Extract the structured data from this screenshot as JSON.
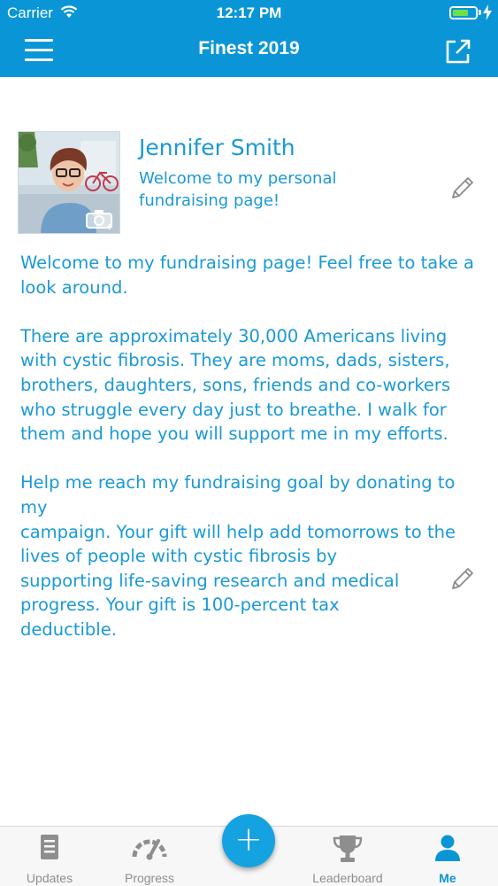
{
  "status_bar": {
    "carrier": "Carrier",
    "time": "12:17 PM",
    "battery_level": 0.7
  },
  "nav": {
    "title": "Finest 2019",
    "menu_icon": "hamburger-menu-icon",
    "share_icon": "external-share-icon"
  },
  "profile": {
    "name": "Jennifer Smith",
    "tagline": "Welcome to my personal fundraising page!",
    "photo_badge_icon": "camera-icon"
  },
  "story": {
    "paragraphs": [
      "Welcome to my fundraising page! Feel free to take a\nlook around.",
      "There are approximately 30,000 Americans living\nwith cystic fibrosis. They are moms, dads, sisters,\nbrothers, daughters, sons, friends and co-workers\nwho struggle every day just to breathe. I walk for\nthem and hope you will support me in my efforts.",
      "Help me reach my fundraising goal by donating to my\ncampaign. Your gift will help add tomorrows to the\nlives of people with cystic fibrosis by\nsupporting life-saving research and medical\nprogress. Your gift is 100-percent tax\ndeductible."
    ]
  },
  "tabs": [
    {
      "label": "Updates",
      "icon": "document-icon",
      "active": false
    },
    {
      "label": "Progress",
      "icon": "gauge-icon",
      "active": false
    },
    {
      "label": "Leaderboard",
      "icon": "trophy-icon",
      "active": false
    },
    {
      "label": "Me",
      "icon": "person-icon",
      "active": true
    }
  ],
  "fab": {
    "label": "+"
  },
  "colors": {
    "brand_blue": "#0a96d6",
    "text_blue": "#1a99d6",
    "tab_inactive": "#8e8e8e",
    "battery_green": "#6ee04b"
  }
}
